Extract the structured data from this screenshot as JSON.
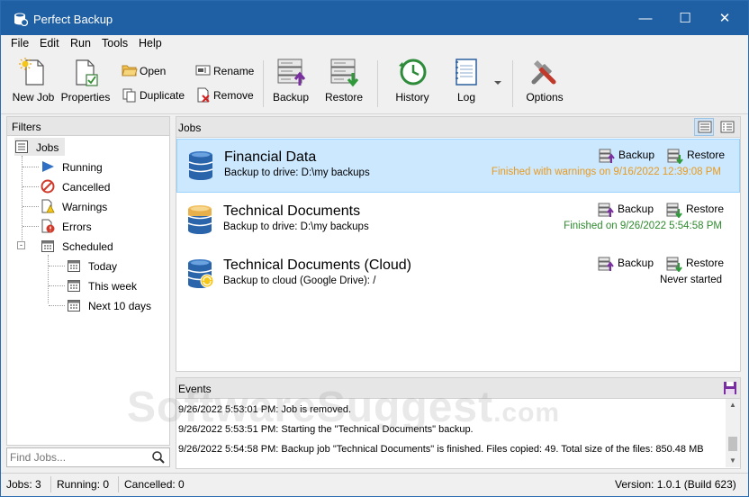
{
  "window": {
    "title": "Perfect Backup",
    "minimize": "—",
    "maximize": "☐",
    "close": "✕"
  },
  "menu": [
    "File",
    "Edit",
    "Run",
    "Tools",
    "Help"
  ],
  "toolbar": {
    "new_job": "New Job",
    "properties": "Properties",
    "open": "Open",
    "duplicate": "Duplicate",
    "rename": "Rename",
    "remove": "Remove",
    "backup": "Backup",
    "restore": "Restore",
    "history": "History",
    "log": "Log",
    "options": "Options"
  },
  "filters": {
    "header": "Filters",
    "items": [
      "Jobs",
      "Running",
      "Cancelled",
      "Warnings",
      "Errors",
      "Scheduled",
      "Today",
      "This week",
      "Next 10 days"
    ],
    "search_placeholder": "Find Jobs..."
  },
  "jobs_panel": {
    "header": "Jobs",
    "jobs": [
      {
        "name": "Financial Data",
        "target": "Backup to drive: D:\\my backups",
        "backup": "Backup",
        "restore": "Restore",
        "status": "Finished with warnings on 9/16/2022 12:39:08 PM",
        "status_color": "#e89a1e"
      },
      {
        "name": "Technical Documents",
        "target": "Backup to drive: D:\\my backups",
        "backup": "Backup",
        "restore": "Restore",
        "status": "Finished on 9/26/2022 5:54:58 PM",
        "status_color": "#2e8b2e"
      },
      {
        "name": "Technical Documents (Cloud)",
        "target": "Backup to cloud (Google Drive): /",
        "backup": "Backup",
        "restore": "Restore",
        "status": "Never started",
        "status_color": "#000000"
      }
    ]
  },
  "events_panel": {
    "header": "Events",
    "rows": [
      "9/26/2022 5:53:01 PM: Job is removed.",
      "9/26/2022 5:53:51 PM: Starting the \"Technical Documents\" backup.",
      "9/26/2022 5:54:58 PM: Backup job \"Technical Documents\" is finished. Files copied: 49. Total size of the files: 850.48 MB"
    ]
  },
  "watermark": {
    "main": "SoftwareSuggest",
    "suffix": ".com"
  },
  "statusbar": {
    "jobs": "Jobs: 3",
    "running": "Running: 0",
    "cancelled": "Cancelled: 0",
    "version": "Version: 1.0.1 (Build 623)"
  },
  "colors": {
    "titlebar": "#1f5fa3",
    "selection": "#cce8ff",
    "accent": "#1e73be"
  }
}
